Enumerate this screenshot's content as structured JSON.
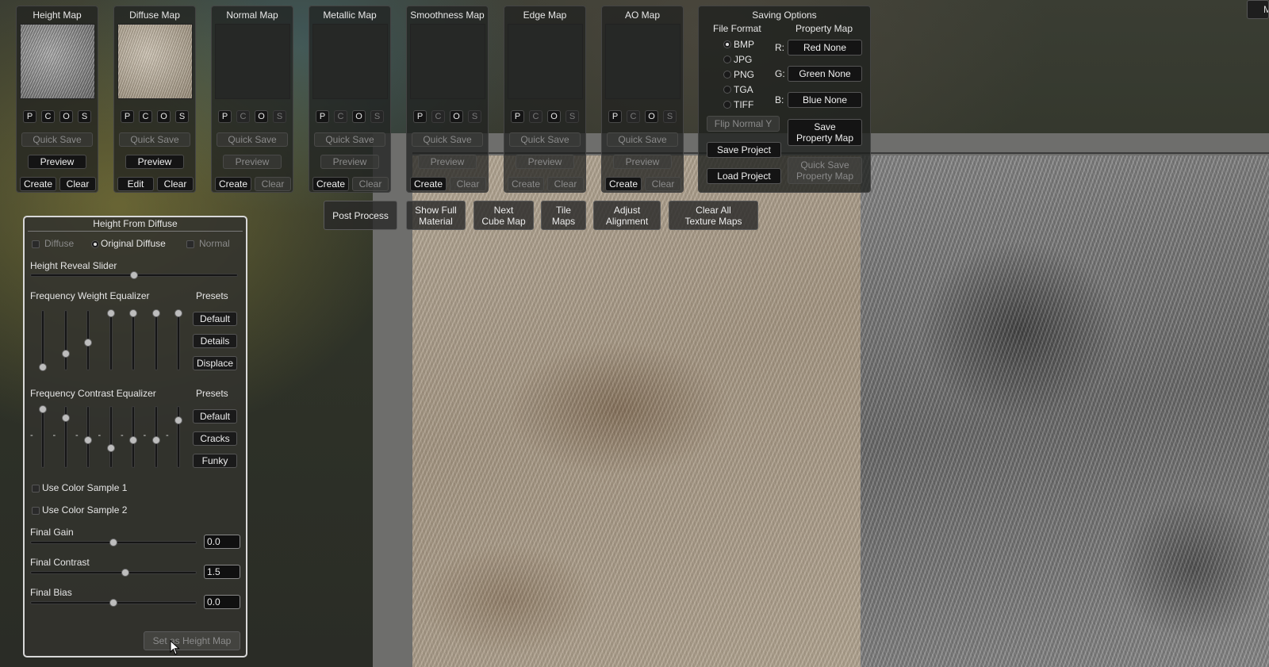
{
  "corner_button": "M",
  "maps": [
    {
      "title": "Height Map",
      "pcos": [
        "P",
        "C",
        "O",
        "S"
      ],
      "quick_save": "Quick Save",
      "preview": "Preview",
      "btn1": "Create",
      "btn2": "Clear"
    },
    {
      "title": "Diffuse Map",
      "pcos": [
        "P",
        "C",
        "O",
        "S"
      ],
      "quick_save": "Quick Save",
      "preview": "Preview",
      "btn1": "Edit",
      "btn2": "Clear"
    },
    {
      "title": "Normal Map",
      "pcos": [
        "P",
        "C",
        "O",
        "S"
      ],
      "quick_save": "Quick Save",
      "preview": "Preview",
      "btn1": "Create",
      "btn2": "Clear"
    },
    {
      "title": "Metallic Map",
      "pcos": [
        "P",
        "C",
        "O",
        "S"
      ],
      "quick_save": "Quick Save",
      "preview": "Preview",
      "btn1": "Create",
      "btn2": "Clear"
    },
    {
      "title": "Smoothness Map",
      "pcos": [
        "P",
        "C",
        "O",
        "S"
      ],
      "quick_save": "Quick Save",
      "preview": "Preview",
      "btn1": "Create",
      "btn2": "Clear"
    },
    {
      "title": "Edge Map",
      "pcos": [
        "P",
        "C",
        "O",
        "S"
      ],
      "quick_save": "Quick Save",
      "preview": "Preview",
      "btn1": "Create",
      "btn2": "Clear"
    },
    {
      "title": "AO Map",
      "pcos": [
        "P",
        "C",
        "O",
        "S"
      ],
      "quick_save": "Quick Save",
      "preview": "Preview",
      "btn1": "Create",
      "btn2": "Clear"
    }
  ],
  "saving": {
    "title": "Saving Options",
    "file_format_label": "File Format",
    "property_map_label": "Property Map",
    "formats": [
      "BMP",
      "JPG",
      "PNG",
      "TGA",
      "TIFF"
    ],
    "selected_format": "BMP",
    "channels": [
      {
        "label": "R:",
        "value": "Red None"
      },
      {
        "label": "G:",
        "value": "Green None"
      },
      {
        "label": "B:",
        "value": "Blue None"
      }
    ],
    "flip_normal": "Flip Normal Y",
    "save_property_map": [
      "Save",
      "Property Map"
    ],
    "save_project": "Save Project",
    "load_project": "Load Project",
    "quick_save_property_map": [
      "Quick Save",
      "Property Map"
    ]
  },
  "actions": [
    [
      "Post Process"
    ],
    [
      "Show Full",
      "Material"
    ],
    [
      "Next",
      "Cube Map"
    ],
    [
      "Tile",
      "Maps"
    ],
    [
      "Adjust",
      "Alignment"
    ],
    [
      "Clear All",
      "Texture Maps"
    ]
  ],
  "hfd": {
    "title": "Height From Diffuse",
    "source_options": [
      "Diffuse",
      "Original Diffuse",
      "Normal"
    ],
    "selected_source": "Original Diffuse",
    "height_reveal_label": "Height Reveal Slider",
    "height_reveal_value": 0.5,
    "freq_weight_label": "Frequency Weight Equalizer",
    "freq_weight_levels": [
      0.0,
      0.25,
      0.45,
      1.0,
      1.0,
      1.0,
      1.0
    ],
    "freq_contrast_label": "Frequency Contrast Equalizer",
    "freq_contrast_levels": [
      1.0,
      0.85,
      0.45,
      0.3,
      0.45,
      0.45,
      0.8
    ],
    "presets_label": "Presets",
    "weight_presets": [
      "Default",
      "Details",
      "Displace"
    ],
    "contrast_presets": [
      "Default",
      "Cracks",
      "Funky"
    ],
    "dash": "-",
    "color_sample_1": "Use Color Sample 1",
    "color_sample_2": "Use Color Sample 2",
    "final_gain_label": "Final Gain",
    "final_gain_value": "0.0",
    "final_gain_pos": 0.5,
    "final_contrast_label": "Final Contrast",
    "final_contrast_value": "1.5",
    "final_contrast_pos": 0.57,
    "final_bias_label": "Final Bias",
    "final_bias_value": "0.0",
    "final_bias_pos": 0.5,
    "set_height_map": "Set as Height Map"
  }
}
